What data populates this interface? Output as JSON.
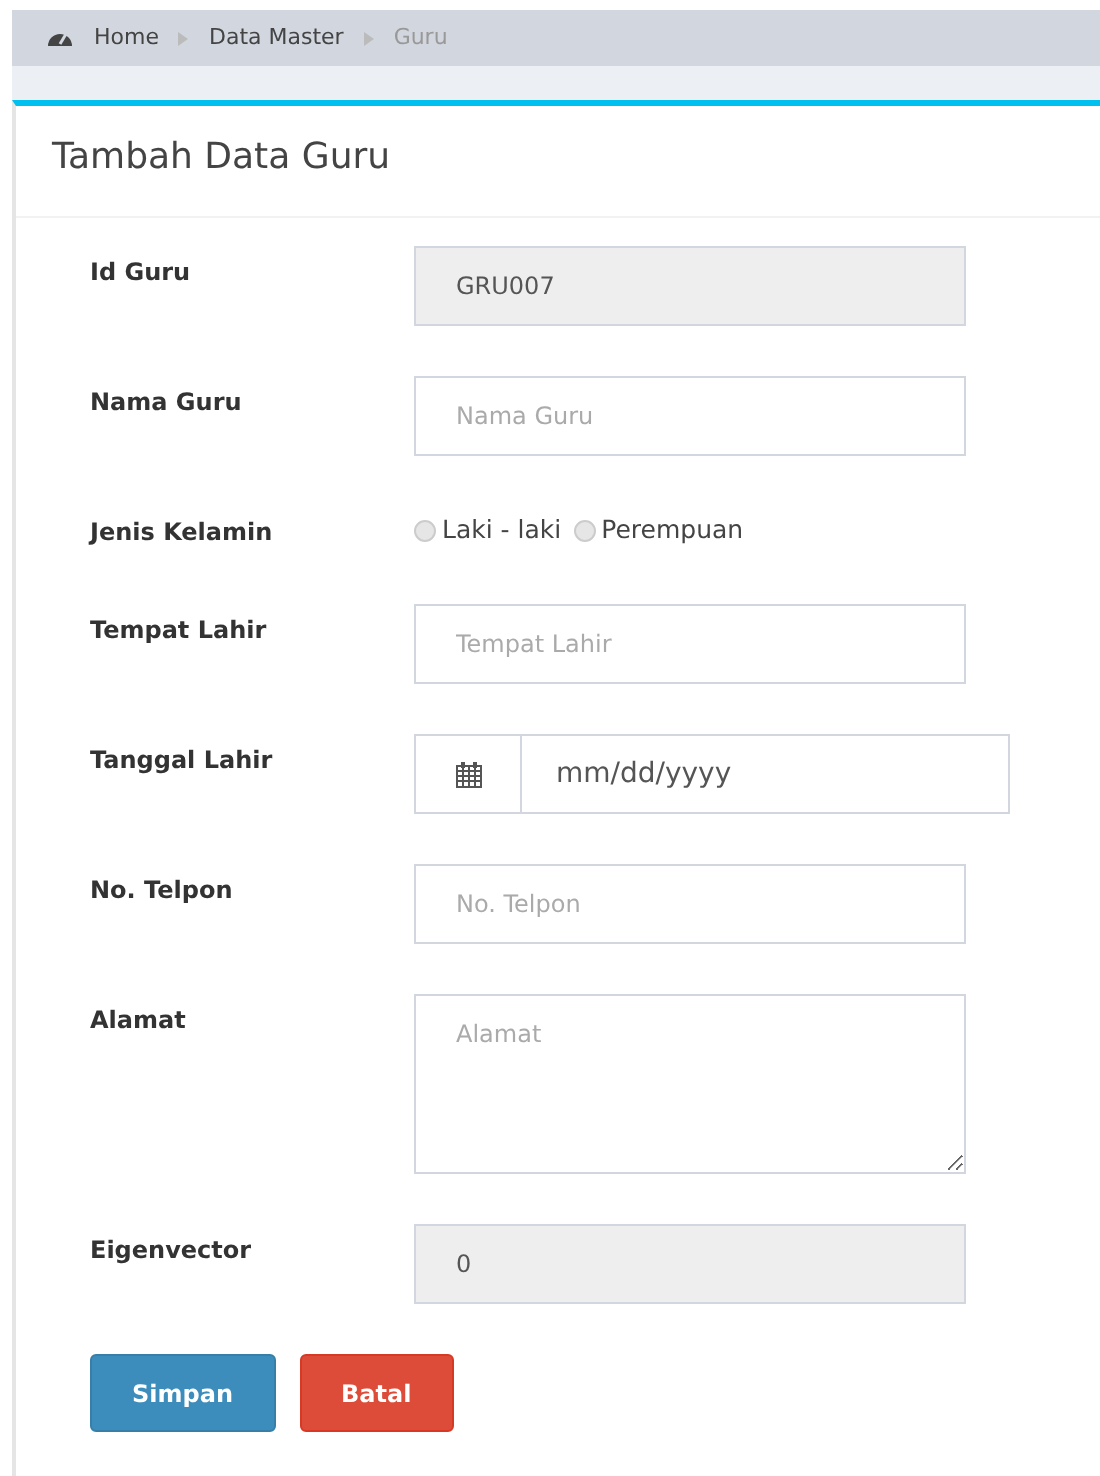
{
  "breadcrumb": [
    {
      "label": "Home",
      "kind": "home"
    },
    {
      "label": "Data Master",
      "kind": "link"
    },
    {
      "label": "Guru",
      "kind": "current"
    }
  ],
  "title": "Tambah Data Guru",
  "fields": [
    {
      "kind": "text",
      "label": "Id Guru",
      "value": "GRU007",
      "disabled": true
    },
    {
      "kind": "text",
      "label": "Nama Guru",
      "placeholder": "Nama Guru",
      "disabled": false
    },
    {
      "kind": "radio",
      "label": "Jenis Kelamin",
      "options": [
        {
          "label": "Laki - laki",
          "selected": false
        },
        {
          "label": "Perempuan",
          "selected": false
        }
      ]
    },
    {
      "kind": "text",
      "label": "Tempat Lahir",
      "placeholder": "Tempat Lahir",
      "disabled": false
    },
    {
      "kind": "date",
      "label": "Tanggal Lahir",
      "placeholder": "mm/dd/yyyy"
    },
    {
      "kind": "text",
      "label": "No. Telpon",
      "placeholder": "No. Telpon",
      "disabled": false
    },
    {
      "kind": "textarea",
      "label": "Alamat",
      "placeholder": "Alamat"
    },
    {
      "kind": "text",
      "label": "Eigenvector",
      "value": "0",
      "disabled": true
    }
  ],
  "buttons": [
    {
      "label": "Simpan",
      "kind": "primary"
    },
    {
      "label": "Batal",
      "kind": "danger"
    }
  ]
}
